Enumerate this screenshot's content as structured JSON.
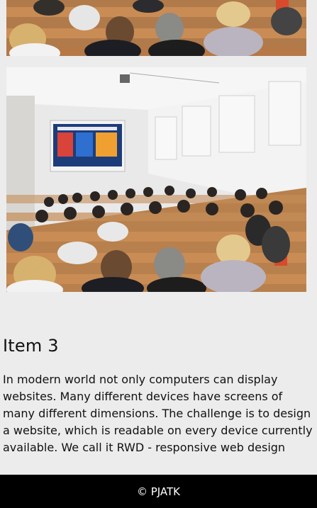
{
  "gallery": {
    "top_photo_alt": "",
    "main_photo_alt": "",
    "slide_colors": [
      "#d8433a",
      "#2e6fd0",
      "#f0a030"
    ]
  },
  "item": {
    "title": "Item 3",
    "text": "In modern world not only computers can display websites. Many different devices have screens of many different dimensions. The challenge is to design a website, which is readable on every device currently available. We call it RWD - responsive web design"
  },
  "footer": {
    "copyright": "© PJATK"
  }
}
